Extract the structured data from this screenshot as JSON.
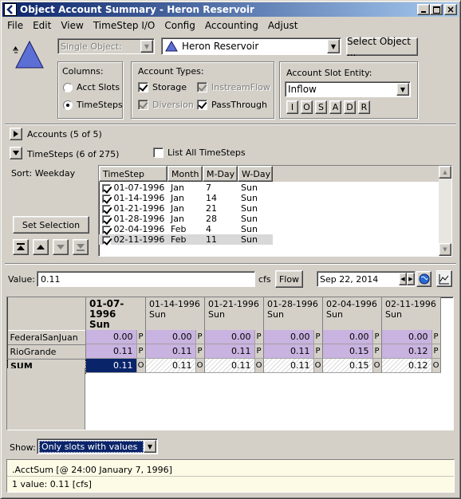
{
  "window": {
    "title": "Object Account Summary - Heron Reservoir"
  },
  "menu": [
    "File",
    "Edit",
    "View",
    "TimeStep I/O",
    "Config",
    "Accounting",
    "Adjust"
  ],
  "top": {
    "mode_select": "Single Object:",
    "object_select": "Heron Reservoir",
    "select_object_button": "Select Object ..."
  },
  "columns": {
    "title": "Columns:",
    "options": [
      {
        "label": "Acct Slots",
        "selected": false
      },
      {
        "label": "TimeSteps",
        "selected": true
      }
    ]
  },
  "account_types": {
    "title": "Account Types:",
    "items": [
      {
        "label": "Storage",
        "checked": true,
        "enabled": true
      },
      {
        "label": "InstreamFlow",
        "checked": true,
        "enabled": false
      },
      {
        "label": "Diversion",
        "checked": true,
        "enabled": false
      },
      {
        "label": "PassThrough",
        "checked": true,
        "enabled": true
      }
    ]
  },
  "slot_entity": {
    "title": "Account Slot Entity:",
    "value": "Inflow",
    "buttons": [
      "I",
      "O",
      "S",
      "A",
      "D",
      "R"
    ]
  },
  "accounts": {
    "label": "Accounts  (5 of 5)"
  },
  "timesteps": {
    "label": "TimeSteps  (6 of 275)",
    "list_all_label": "List All TimeSteps",
    "list_all_checked": false
  },
  "sort": {
    "label": "Sort: Weekday"
  },
  "set_selection_button": "Set Selection",
  "ts_table": {
    "headers": [
      "TimeStep",
      "Month",
      "M-Day",
      "W-Day"
    ],
    "rows": [
      {
        "date": "01-07-1996",
        "month": "Jan",
        "mday": "7",
        "wday": "Sun"
      },
      {
        "date": "01-14-1996",
        "month": "Jan",
        "mday": "14",
        "wday": "Sun"
      },
      {
        "date": "01-21-1996",
        "month": "Jan",
        "mday": "21",
        "wday": "Sun"
      },
      {
        "date": "01-28-1996",
        "month": "Jan",
        "mday": "28",
        "wday": "Sun"
      },
      {
        "date": "02-04-1996",
        "month": "Feb",
        "mday": "4",
        "wday": "Sun"
      },
      {
        "date": "02-11-1996",
        "month": "Feb",
        "mday": "11",
        "wday": "Sun"
      }
    ]
  },
  "value_bar": {
    "label": "Value:",
    "value": "0.11",
    "unit": "cfs",
    "flow_button": "Flow",
    "date": "Sep 22, 2014"
  },
  "grid": {
    "columns": [
      {
        "date": "01-07-1996",
        "day": "Sun"
      },
      {
        "date": "01-14-1996",
        "day": "Sun"
      },
      {
        "date": "01-21-1996",
        "day": "Sun"
      },
      {
        "date": "01-28-1996",
        "day": "Sun"
      },
      {
        "date": "02-04-1996",
        "day": "Sun"
      },
      {
        "date": "02-11-1996",
        "day": "Sun"
      }
    ],
    "rows": [
      {
        "name": "FederalSanJuan",
        "flag": "P",
        "values": [
          "0.00",
          "0.00",
          "0.00",
          "0.00",
          "0.00",
          "0.00"
        ]
      },
      {
        "name": "RioGrande",
        "flag": "P",
        "values": [
          "0.11",
          "0.11",
          "0.11",
          "0.11",
          "0.15",
          "0.12"
        ]
      },
      {
        "name": "SUM",
        "flag": "O",
        "values": [
          "0.11",
          "0.11",
          "0.11",
          "0.11",
          "0.15",
          "0.12"
        ]
      }
    ]
  },
  "show": {
    "label": "Show:",
    "value": "Only slots with values"
  },
  "status": {
    "line1": ".AcctSum [@ 24:00 January 7, 1996]",
    "line2": "1 value:  0.11 [cfs]"
  },
  "colors": {
    "title_bar": "#0a246a",
    "account_cell": "#c9b3e0",
    "selected_cell": "#0a246a"
  }
}
